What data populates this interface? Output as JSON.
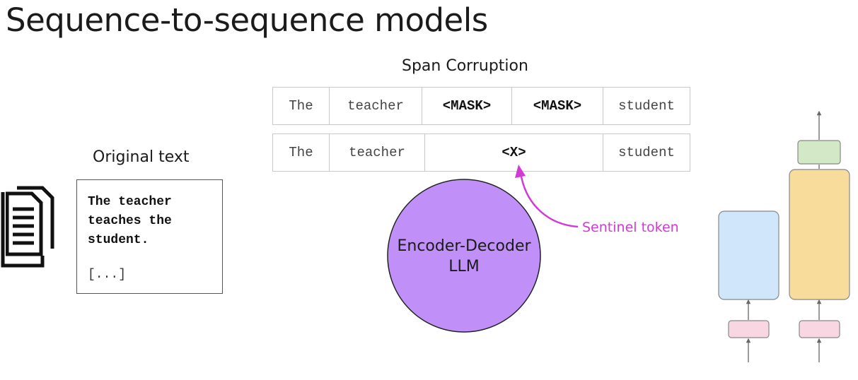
{
  "slide": {
    "title": "Sequence-to-sequence models"
  },
  "original": {
    "caption": "Original text",
    "text_lines": [
      "The teacher",
      "teaches the",
      "student."
    ],
    "ellipsis": "[...]"
  },
  "span_corruption": {
    "caption": "Span Corruption",
    "masked_row": [
      "The",
      "teacher",
      "<MASK>",
      "<MASK>",
      "student"
    ],
    "sentinel_row": [
      "The",
      "teacher",
      "<X>",
      "student"
    ]
  },
  "model": {
    "label": "Encoder-Decoder LLM",
    "label_lines": [
      "Encoder-Decoder",
      "LLM"
    ],
    "color": "#c18ff8"
  },
  "annotation": {
    "sentinel_label": "Sentinel token",
    "color": "#d23ad6"
  },
  "architecture": {
    "encoder_color": "#cfe6fb",
    "decoder_color": "#f8dc9c",
    "output_color": "#d3e8c7",
    "embedding_color": "#f8d7e2"
  }
}
